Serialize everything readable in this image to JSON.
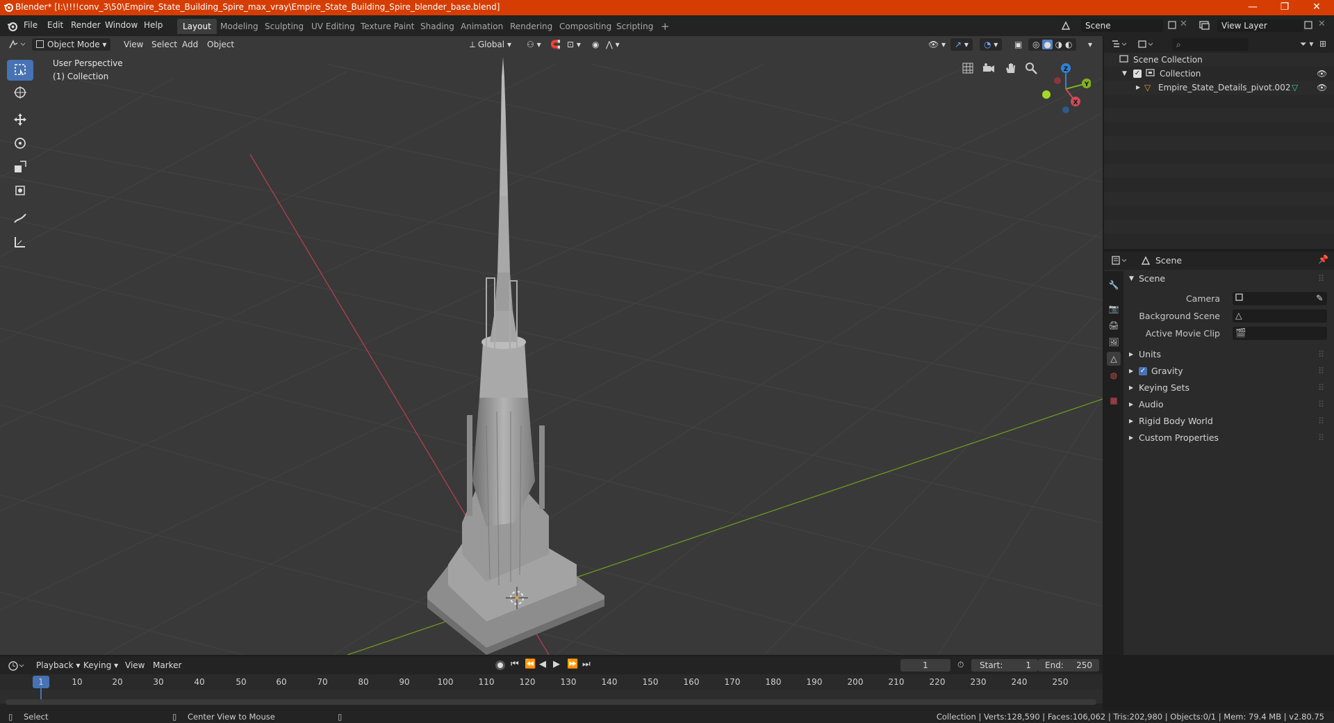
{
  "title_bar": {
    "title": "Blender* [I:\\!!!!conv_3\\50\\Empire_State_Building_Spire_max_vray\\Empire_State_Building_Spire_blender_base.blend]",
    "minimize": "—",
    "restore": "❐",
    "close": "✕"
  },
  "menu": [
    "File",
    "Edit",
    "Render",
    "Window",
    "Help"
  ],
  "workspaces": [
    "Layout",
    "Modeling",
    "Sculpting",
    "UV Editing",
    "Texture Paint",
    "Shading",
    "Animation",
    "Rendering",
    "Compositing",
    "Scripting"
  ],
  "add_workspace": "+",
  "scene_field": "Scene",
  "view_layer_field": "View Layer",
  "viewport_header": {
    "mode": "Object Mode",
    "menus": [
      "View",
      "Select",
      "Add",
      "Object"
    ],
    "transform": "Global"
  },
  "viewport_overlay": {
    "perspective": "User Perspective",
    "collection": "(1) Collection"
  },
  "gizmo": {
    "z": "Z",
    "y": "Y",
    "x": "X"
  },
  "outliner": {
    "search_placeholder": "",
    "rows": [
      {
        "label": "Scene Collection"
      },
      {
        "label": "Collection"
      },
      {
        "label": "Empire_State_Details_pivot.002"
      }
    ]
  },
  "properties": {
    "header": "Scene",
    "panel": "Scene",
    "fields": [
      {
        "label": "Camera"
      },
      {
        "label": "Background Scene"
      },
      {
        "label": "Active Movie Clip"
      }
    ],
    "sections": [
      "Units",
      "Gravity",
      "Keying Sets",
      "Audio",
      "Rigid Body World",
      "Custom Properties"
    ]
  },
  "timeline": {
    "menus": [
      "Playback",
      "Keying",
      "View",
      "Marker"
    ],
    "current_frame": "1",
    "start_label": "Start:",
    "start": "1",
    "end_label": "End:",
    "end": "250",
    "ticks": [
      "1",
      "10",
      "20",
      "30",
      "40",
      "50",
      "60",
      "70",
      "80",
      "90",
      "100",
      "110",
      "120",
      "130",
      "140",
      "150",
      "160",
      "170",
      "180",
      "190",
      "200",
      "210",
      "220",
      "230",
      "240",
      "250"
    ]
  },
  "status_bar": {
    "left": "Select",
    "middle": "Center View to Mouse",
    "right": "Collection | Verts:128,590 | Faces:106,062 | Tris:202,980 | Objects:0/1 | Mem: 79.4 MB | v2.80.75"
  },
  "colors": {
    "title_bar": "#d63d03",
    "active": "#4772b3",
    "x_axis": "#d04a5a",
    "y_axis": "#7fb21f",
    "z_axis": "#2f83d9"
  }
}
